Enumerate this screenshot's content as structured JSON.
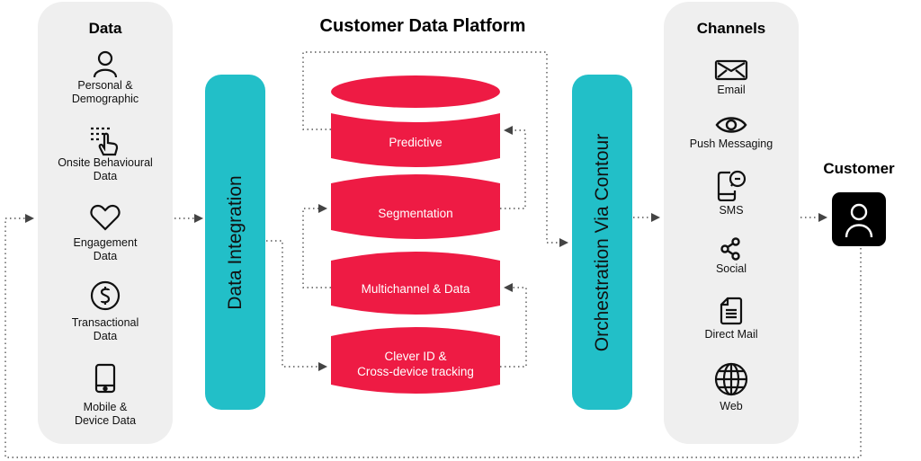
{
  "title": "Customer Data Platform",
  "colors": {
    "accent_red": "#ee1b44",
    "accent_teal": "#22bfc8",
    "panel_bg": "#efefef",
    "arrow": "#444444"
  },
  "data_panel": {
    "title": "Data",
    "items": [
      {
        "icon": "person-icon",
        "label_line1": "Personal &",
        "label_line2": "Demographic"
      },
      {
        "icon": "touch-list-icon",
        "label_line1": "Onsite Behavioural",
        "label_line2": "Data"
      },
      {
        "icon": "heart-icon",
        "label_line1": "Engagement",
        "label_line2": "Data"
      },
      {
        "icon": "dollar-circle-icon",
        "label_line1": "Transactional",
        "label_line2": "Data"
      },
      {
        "icon": "mobile-phone-icon",
        "label_line1": "Mobile &",
        "label_line2": "Device Data"
      }
    ]
  },
  "integration_bar": {
    "label": "Data Integration"
  },
  "cdp": {
    "segments": [
      {
        "label_line1": "Predictive",
        "label_line2": ""
      },
      {
        "label_line1": "Segmentation",
        "label_line2": ""
      },
      {
        "label_line1": "Multichannel & Data",
        "label_line2": ""
      },
      {
        "label_line1": "Clever ID &",
        "label_line2": "Cross-device tracking"
      }
    ]
  },
  "orchestration_bar": {
    "label": "Orchestration Via Contour"
  },
  "channels_panel": {
    "title": "Channels",
    "items": [
      {
        "icon": "envelope-icon",
        "label": "Email"
      },
      {
        "icon": "eye-icon",
        "label": "Push Messaging"
      },
      {
        "icon": "sms-phone-icon",
        "label": "SMS"
      },
      {
        "icon": "share-icon",
        "label": "Social"
      },
      {
        "icon": "document-icon",
        "label": "Direct Mail"
      },
      {
        "icon": "globe-icon",
        "label": "Web"
      }
    ]
  },
  "customer": {
    "title": "Customer",
    "icon": "person-icon"
  }
}
